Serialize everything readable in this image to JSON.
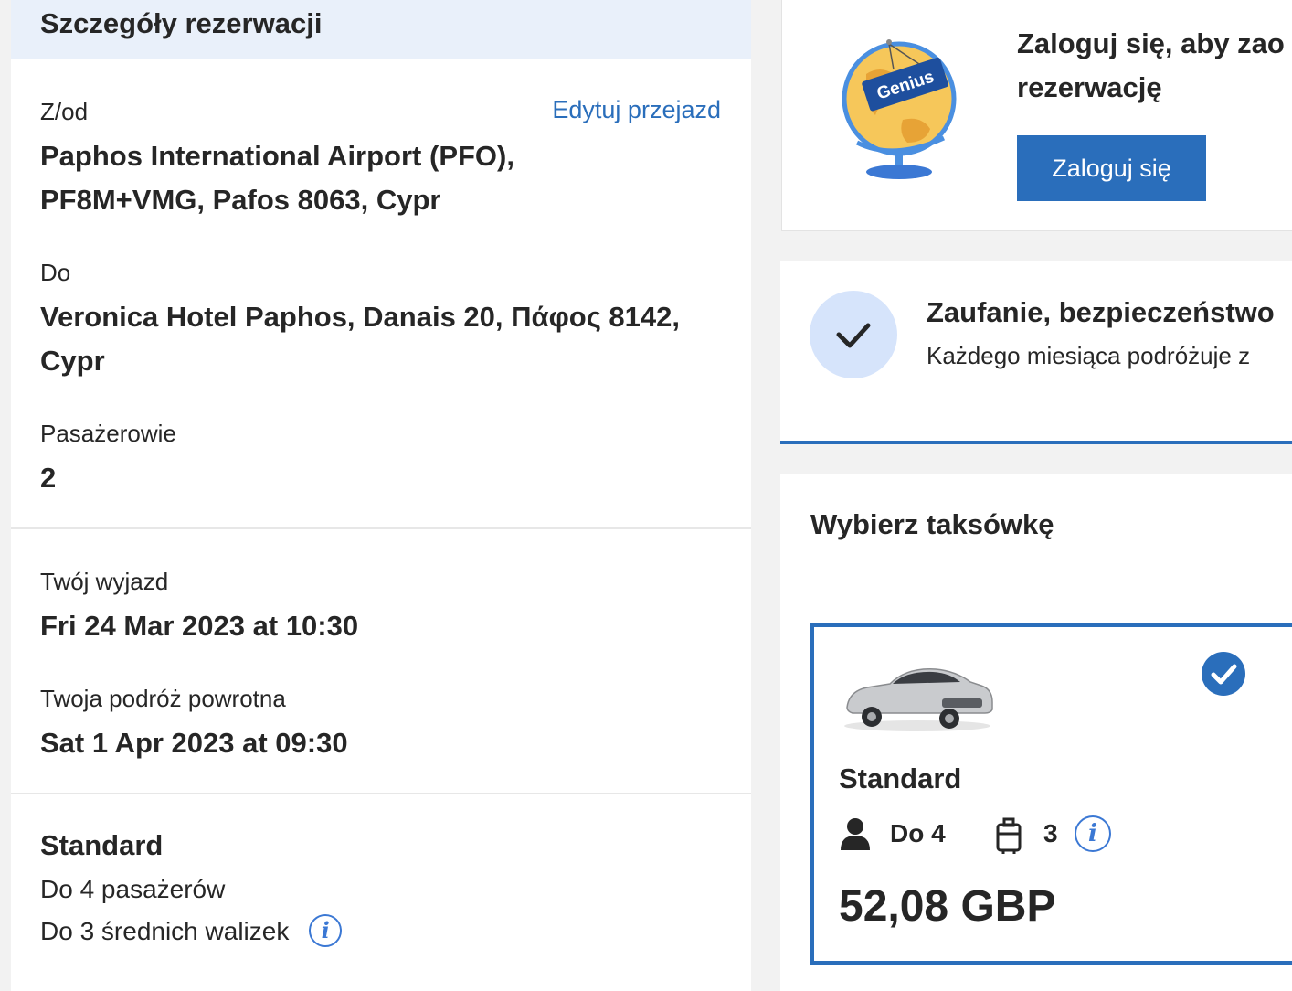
{
  "booking": {
    "header": "Szczegóły rezerwacji",
    "from_label": "Z/od",
    "edit_link": "Edytuj przejazd",
    "from_value_line1": "Paphos International Airport (PFO),",
    "from_value_line2": "PF8M+VMG, Pafos 8063, Cypr",
    "to_label": "Do",
    "to_value_line1": "Veronica Hotel Paphos, Danais 20, Πάφος 8142,",
    "to_value_line2": "Cypr",
    "passengers_label": "Pasażerowie",
    "passengers_value": "2",
    "departure_label": "Twój wyjazd",
    "departure_value": "Fri 24 Mar 2023 at 10:30",
    "return_label": "Twoja podróż powrotna",
    "return_value": "Sat 1 Apr 2023 at 09:30",
    "vehicle_name": "Standard",
    "vehicle_passengers": "Do 4 pasażerów",
    "vehicle_luggage": "Do 3 średnich walizek"
  },
  "login_card": {
    "text_line1": "Zaloguj się, aby zao",
    "text_line2": "rezerwację",
    "button": "Zaloguj się",
    "badge_text": "Genius"
  },
  "trust_card": {
    "title": "Zaufanie, bezpieczeństwo",
    "subtitle": "Każdego miesiąca podróżuje z"
  },
  "taxi": {
    "title": "Wybierz taksówkę",
    "option": {
      "name": "Standard",
      "passengers": "Do 4",
      "luggage": "3",
      "price": "52,08 GBP",
      "selected": true
    }
  },
  "colors": {
    "accent": "#2a6ebb",
    "header_bg": "#e9f0fa",
    "check_bg": "#d6e4fb"
  },
  "icons": [
    "info-icon",
    "check-icon",
    "globe-icon",
    "person-icon",
    "luggage-icon",
    "selected-check-icon",
    "car-image"
  ]
}
